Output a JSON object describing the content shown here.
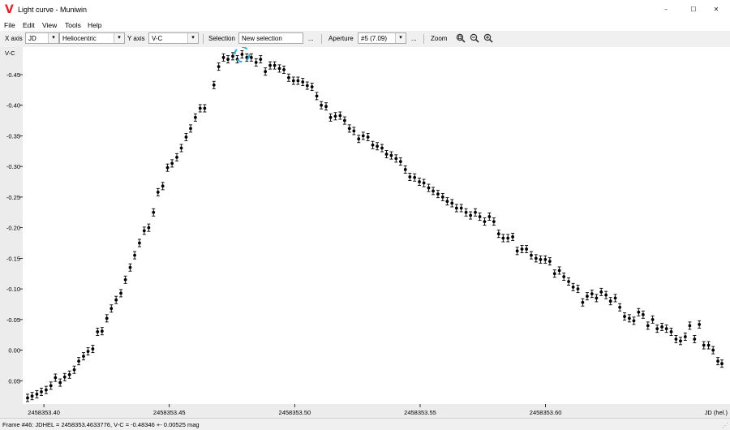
{
  "window": {
    "title": "Light curve - Muniwin",
    "logo": "V"
  },
  "window_controls": {
    "minimize": "–",
    "maximize": "☐",
    "close": "✕"
  },
  "menu": {
    "file": "File",
    "edit": "Edit",
    "view": "View",
    "tools": "Tools",
    "help": "Help"
  },
  "toolbar": {
    "x_axis_label": "X axis",
    "x_axis_value": "JD",
    "x_mode_value": "Heliocentric",
    "y_axis_label": "Y axis",
    "y_axis_value": "V-C",
    "selection_label": "Selection",
    "selection_value": "New selection",
    "ellipsis": "...",
    "aperture_label": "Aperture",
    "aperture_value": "#5 (7.09)",
    "zoom_label": "Zoom",
    "zoom_icons": [
      "zoom-fit-icon",
      "zoom-out-icon",
      "zoom-in-icon"
    ]
  },
  "status": {
    "text": "Frame #46: JDHEL = 2458353.4633776, V-C = -0.48346 +- 0.00525 mag"
  },
  "chart_data": {
    "type": "scatter",
    "ylabel": "V-C",
    "xlabel": "JD (hel.)",
    "xlim": [
      2458353.3935,
      2458353.6703
    ],
    "ylim": [
      0.088,
      -0.495
    ],
    "y_inverted": true,
    "x_ticks": [
      2458353.4,
      2458353.45,
      2458353.5,
      2458353.55,
      2458353.6
    ],
    "x_tick_labels": [
      "2458353.40",
      "2458353.45",
      "2458353.50",
      "2458353.55",
      "2458353.60"
    ],
    "y_ticks": [
      -0.45,
      -0.4,
      -0.35,
      -0.3,
      -0.25,
      -0.2,
      -0.15,
      -0.1,
      -0.05,
      0.0,
      0.05
    ],
    "y_tick_labels": [
      "-0.45",
      "-0.40",
      "-0.35",
      "-0.30",
      "-0.25",
      "-0.20",
      "-0.15",
      "-0.10",
      "-0.05",
      "0.00",
      "0.05"
    ],
    "marker_color": "#000000",
    "highlight_color": "#2aaed8",
    "selected_index": 45,
    "points": [
      [
        2458353.3935,
        0.078,
        0.006
      ],
      [
        2458353.3953,
        0.075,
        0.006
      ],
      [
        2458353.3972,
        0.072,
        0.006
      ],
      [
        2458353.399,
        0.068,
        0.006
      ],
      [
        2458353.4009,
        0.065,
        0.006
      ],
      [
        2458353.4028,
        0.058,
        0.006
      ],
      [
        2458353.4046,
        0.045,
        0.006
      ],
      [
        2458353.4065,
        0.053,
        0.006
      ],
      [
        2458353.4083,
        0.044,
        0.006
      ],
      [
        2458353.4102,
        0.04,
        0.006
      ],
      [
        2458353.4121,
        0.032,
        0.006
      ],
      [
        2458353.4139,
        0.018,
        0.006
      ],
      [
        2458353.4158,
        0.01,
        0.006
      ],
      [
        2458353.4176,
        0.002,
        0.006
      ],
      [
        2458353.4195,
        -0.002,
        0.006
      ],
      [
        2458353.4214,
        -0.03,
        0.006
      ],
      [
        2458353.4232,
        -0.031,
        0.006
      ],
      [
        2458353.4251,
        -0.052,
        0.006
      ],
      [
        2458353.4269,
        -0.068,
        0.006
      ],
      [
        2458353.4288,
        -0.082,
        0.006
      ],
      [
        2458353.4307,
        -0.093,
        0.006
      ],
      [
        2458353.4325,
        -0.115,
        0.006
      ],
      [
        2458353.4344,
        -0.135,
        0.006
      ],
      [
        2458353.4362,
        -0.155,
        0.006
      ],
      [
        2458353.4381,
        -0.175,
        0.006
      ],
      [
        2458353.44,
        -0.195,
        0.006
      ],
      [
        2458353.4418,
        -0.2,
        0.006
      ],
      [
        2458353.4437,
        -0.225,
        0.006
      ],
      [
        2458353.4455,
        -0.258,
        0.006
      ],
      [
        2458353.4474,
        -0.268,
        0.006
      ],
      [
        2458353.4493,
        -0.298,
        0.006
      ],
      [
        2458353.4511,
        -0.305,
        0.006
      ],
      [
        2458353.453,
        -0.315,
        0.006
      ],
      [
        2458353.4548,
        -0.33,
        0.006
      ],
      [
        2458353.4567,
        -0.348,
        0.006
      ],
      [
        2458353.4585,
        -0.362,
        0.006
      ],
      [
        2458353.4604,
        -0.38,
        0.006
      ],
      [
        2458353.4623,
        -0.395,
        0.006
      ],
      [
        2458353.4641,
        -0.395,
        0.006
      ],
      [
        2458353.4678,
        -0.433,
        0.006
      ],
      [
        2458353.4697,
        -0.463,
        0.006
      ],
      [
        2458353.4716,
        -0.478,
        0.006
      ],
      [
        2458353.4734,
        -0.475,
        0.006
      ],
      [
        2458353.4753,
        -0.48,
        0.006
      ],
      [
        2458353.4771,
        -0.475,
        0.006
      ],
      [
        2458353.479,
        -0.483,
        0.006
      ],
      [
        2458353.4809,
        -0.478,
        0.006
      ],
      [
        2458353.4827,
        -0.478,
        0.006
      ],
      [
        2458353.4846,
        -0.47,
        0.006
      ],
      [
        2458353.4864,
        -0.475,
        0.006
      ],
      [
        2458353.4883,
        -0.455,
        0.006
      ],
      [
        2458353.4902,
        -0.465,
        0.006
      ],
      [
        2458353.492,
        -0.465,
        0.006
      ],
      [
        2458353.4939,
        -0.46,
        0.006
      ],
      [
        2458353.4957,
        -0.458,
        0.006
      ],
      [
        2458353.4976,
        -0.445,
        0.006
      ],
      [
        2458353.4995,
        -0.44,
        0.006
      ],
      [
        2458353.5013,
        -0.44,
        0.006
      ],
      [
        2458353.5032,
        -0.438,
        0.006
      ],
      [
        2458353.505,
        -0.432,
        0.006
      ],
      [
        2458353.5069,
        -0.43,
        0.006
      ],
      [
        2458353.5088,
        -0.415,
        0.006
      ],
      [
        2458353.5106,
        -0.4,
        0.006
      ],
      [
        2458353.5125,
        -0.398,
        0.006
      ],
      [
        2458353.5143,
        -0.38,
        0.006
      ],
      [
        2458353.5162,
        -0.382,
        0.006
      ],
      [
        2458353.5181,
        -0.383,
        0.006
      ],
      [
        2458353.5199,
        -0.375,
        0.006
      ],
      [
        2458353.5218,
        -0.362,
        0.006
      ],
      [
        2458353.5236,
        -0.358,
        0.006
      ],
      [
        2458353.5255,
        -0.345,
        0.006
      ],
      [
        2458353.5273,
        -0.35,
        0.006
      ],
      [
        2458353.5292,
        -0.348,
        0.006
      ],
      [
        2458353.5311,
        -0.335,
        0.006
      ],
      [
        2458353.5329,
        -0.333,
        0.006
      ],
      [
        2458353.5348,
        -0.33,
        0.006
      ],
      [
        2458353.5366,
        -0.32,
        0.006
      ],
      [
        2458353.5385,
        -0.318,
        0.006
      ],
      [
        2458353.5404,
        -0.313,
        0.006
      ],
      [
        2458353.5422,
        -0.308,
        0.006
      ],
      [
        2458353.5441,
        -0.295,
        0.006
      ],
      [
        2458353.5459,
        -0.283,
        0.006
      ],
      [
        2458353.5478,
        -0.282,
        0.006
      ],
      [
        2458353.5497,
        -0.275,
        0.006
      ],
      [
        2458353.5515,
        -0.273,
        0.006
      ],
      [
        2458353.5534,
        -0.265,
        0.006
      ],
      [
        2458353.5552,
        -0.26,
        0.006
      ],
      [
        2458353.5571,
        -0.255,
        0.006
      ],
      [
        2458353.559,
        -0.25,
        0.006
      ],
      [
        2458353.5608,
        -0.243,
        0.006
      ],
      [
        2458353.5627,
        -0.24,
        0.006
      ],
      [
        2458353.5645,
        -0.232,
        0.006
      ],
      [
        2458353.5664,
        -0.232,
        0.006
      ],
      [
        2458353.5683,
        -0.225,
        0.006
      ],
      [
        2458353.5701,
        -0.22,
        0.006
      ],
      [
        2458353.572,
        -0.225,
        0.006
      ],
      [
        2458353.5738,
        -0.218,
        0.006
      ],
      [
        2458353.5757,
        -0.21,
        0.006
      ],
      [
        2458353.5776,
        -0.218,
        0.006
      ],
      [
        2458353.5794,
        -0.21,
        0.006
      ],
      [
        2458353.5813,
        -0.19,
        0.006
      ],
      [
        2458353.5831,
        -0.183,
        0.006
      ],
      [
        2458353.585,
        -0.183,
        0.006
      ],
      [
        2458353.5869,
        -0.185,
        0.006
      ],
      [
        2458353.5887,
        -0.162,
        0.006
      ],
      [
        2458353.5906,
        -0.165,
        0.006
      ],
      [
        2458353.5924,
        -0.165,
        0.006
      ],
      [
        2458353.5943,
        -0.155,
        0.006
      ],
      [
        2458353.5962,
        -0.15,
        0.006
      ],
      [
        2458353.598,
        -0.148,
        0.006
      ],
      [
        2458353.5999,
        -0.148,
        0.006
      ],
      [
        2458353.6017,
        -0.145,
        0.006
      ],
      [
        2458353.6036,
        -0.125,
        0.006
      ],
      [
        2458353.6055,
        -0.13,
        0.006
      ],
      [
        2458353.6073,
        -0.12,
        0.006
      ],
      [
        2458353.6092,
        -0.112,
        0.006
      ],
      [
        2458353.611,
        -0.103,
        0.006
      ],
      [
        2458353.6129,
        -0.1,
        0.006
      ],
      [
        2458353.6148,
        -0.078,
        0.006
      ],
      [
        2458353.6166,
        -0.088,
        0.006
      ],
      [
        2458353.6185,
        -0.092,
        0.006
      ],
      [
        2458353.6203,
        -0.085,
        0.006
      ],
      [
        2458353.6222,
        -0.095,
        0.006
      ],
      [
        2458353.6241,
        -0.09,
        0.006
      ],
      [
        2458353.6259,
        -0.08,
        0.006
      ],
      [
        2458353.6278,
        -0.085,
        0.006
      ],
      [
        2458353.6296,
        -0.07,
        0.006
      ],
      [
        2458353.6315,
        -0.055,
        0.006
      ],
      [
        2458353.6334,
        -0.052,
        0.006
      ],
      [
        2458353.6352,
        -0.048,
        0.006
      ],
      [
        2458353.6371,
        -0.062,
        0.006
      ],
      [
        2458353.6389,
        -0.058,
        0.006
      ],
      [
        2458353.6408,
        -0.04,
        0.006
      ],
      [
        2458353.6427,
        -0.05,
        0.006
      ],
      [
        2458353.6445,
        -0.035,
        0.006
      ],
      [
        2458353.6464,
        -0.038,
        0.006
      ],
      [
        2458353.6482,
        -0.035,
        0.006
      ],
      [
        2458353.6501,
        -0.03,
        0.006
      ],
      [
        2458353.652,
        -0.018,
        0.006
      ],
      [
        2458353.6538,
        -0.015,
        0.006
      ],
      [
        2458353.6557,
        -0.022,
        0.006
      ],
      [
        2458353.6575,
        -0.04,
        0.006
      ],
      [
        2458353.6594,
        -0.018,
        0.006
      ],
      [
        2458353.6613,
        -0.042,
        0.006
      ],
      [
        2458353.6631,
        -0.008,
        0.006
      ],
      [
        2458353.665,
        -0.008,
        0.006
      ],
      [
        2458353.6668,
        0.0,
        0.006
      ],
      [
        2458353.6687,
        0.018,
        0.006
      ],
      [
        2458353.6703,
        0.022,
        0.006
      ]
    ]
  }
}
